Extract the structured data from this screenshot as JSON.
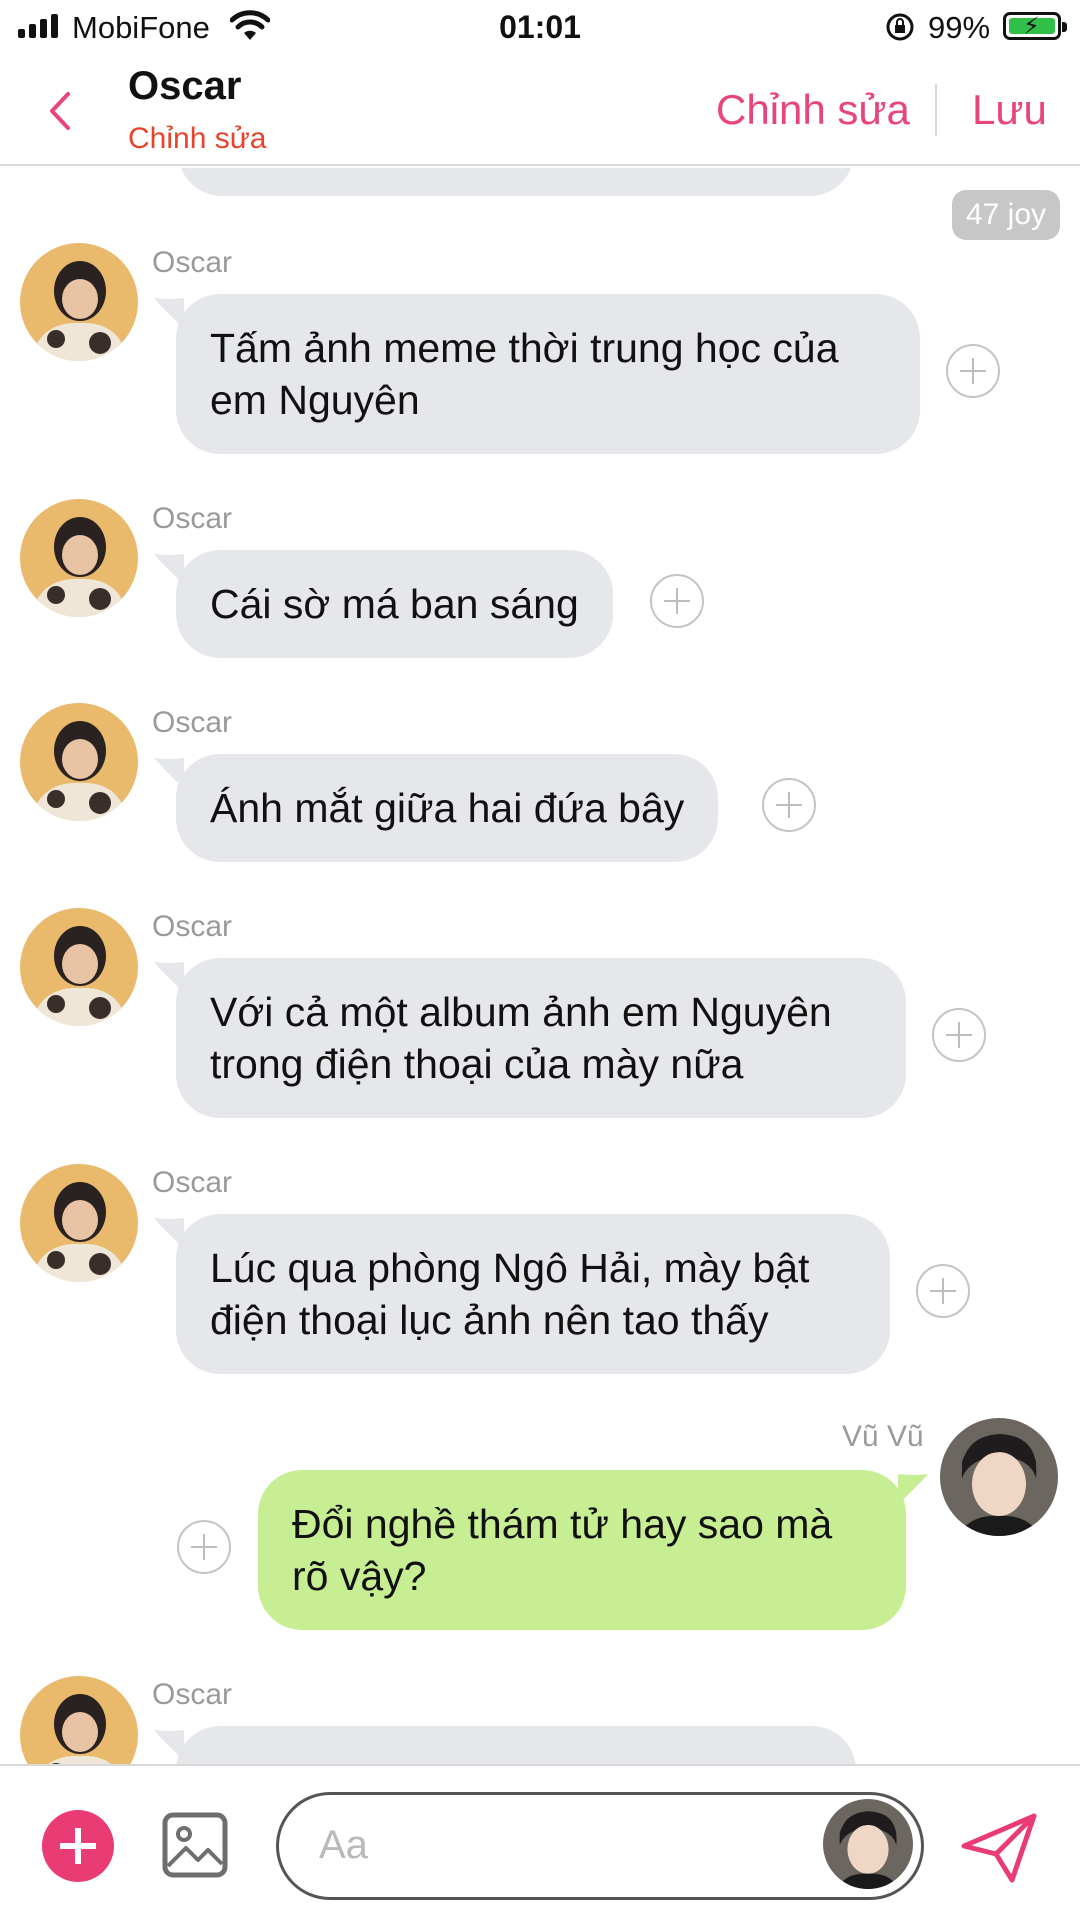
{
  "status_bar": {
    "carrier": "MobiFone",
    "time": "01:01",
    "battery_percent": "99%"
  },
  "header": {
    "back_icon": "chevron-left-icon",
    "title": "Oscar",
    "subtitle": "Chỉnh sửa",
    "edit_label": "Chỉnh sửa",
    "save_label": "Lưu",
    "accent_color": "#e8457b",
    "subtitle_color": "#e8442c"
  },
  "chat": {
    "joy_badge": "47 joy",
    "messages": [
      {
        "sender": "Oscar",
        "text": "Tấm ảnh meme thời trung học của em Nguyên"
      },
      {
        "sender": "Oscar",
        "text": "Cái sờ má ban sáng"
      },
      {
        "sender": "Oscar",
        "text": "Ánh mắt giữa hai đứa bây"
      },
      {
        "sender": "Oscar",
        "text": "Với cả một album ảnh em Nguyên trong điện thoại của mày nữa"
      },
      {
        "sender": "Oscar",
        "text": "Lúc qua phòng Ngô Hải, mày bật điện thoại lục ảnh nên tao thấy"
      },
      {
        "sender": "Vũ Vũ",
        "text": "Đổi nghề thám tử hay sao mà rõ vậy?"
      },
      {
        "sender": "Oscar",
        "text": ""
      }
    ],
    "incoming_bubble_color": "#e5e7eb",
    "outgoing_bubble_color": "#c8ee94"
  },
  "composer": {
    "placeholder": "Aa",
    "plus_icon": "plus-icon",
    "image_icon": "image-icon",
    "send_icon": "send-icon",
    "plus_color": "#ea3c74"
  }
}
